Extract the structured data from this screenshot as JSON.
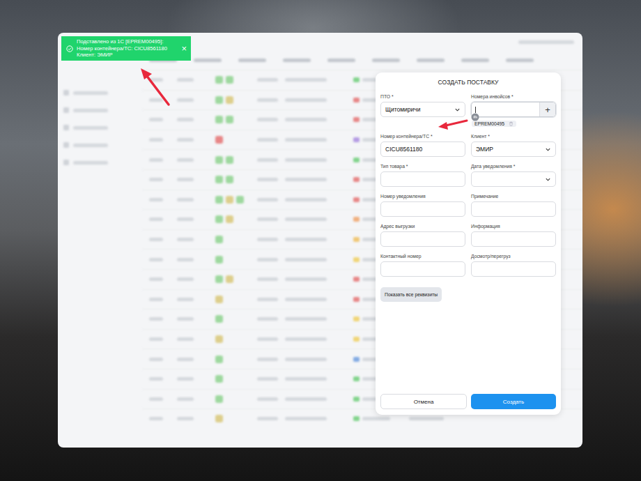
{
  "toast": {
    "lines": [
      "Подставлено из 1С [EPREM00495]:",
      "Номер контейнера/ТС: CICU8561180",
      "Клиент: ЭМИР"
    ],
    "close": "×"
  },
  "dialog": {
    "title": "СОЗДАТЬ ПОСТАВКУ",
    "fields": [
      {
        "label": "ПТО *",
        "kind": "select",
        "value": "Щитомиричи"
      },
      {
        "label": "Номера инвойсов *",
        "kind": "invoice",
        "value": "",
        "add": "+",
        "chips": [
          "EPREM00495"
        ]
      },
      {
        "label": "Номер контейнера/ТС *",
        "kind": "text",
        "value": "CICU8561180"
      },
      {
        "label": "Клиент *",
        "kind": "select",
        "value": "ЭМИР"
      },
      {
        "label": "Тип товара *",
        "kind": "text",
        "value": ""
      },
      {
        "label": "Дата уведомления *",
        "kind": "select",
        "value": ""
      },
      {
        "label": "Номер уведомления",
        "kind": "text",
        "value": ""
      },
      {
        "label": "Примечание",
        "kind": "text",
        "value": ""
      },
      {
        "label": "Адрес выгрузки",
        "kind": "text",
        "value": ""
      },
      {
        "label": "Информация",
        "kind": "text",
        "value": ""
      },
      {
        "label": "Контактный номер",
        "kind": "text",
        "value": ""
      },
      {
        "label": "Досмотр/перегруз",
        "kind": "text",
        "value": ""
      }
    ],
    "more_button": "Показать все реквизиты",
    "buttons": [
      {
        "label": "Отмена",
        "kind": "secondary"
      },
      {
        "label": "Создать",
        "kind": "primary"
      }
    ]
  },
  "background_table": {
    "rows": [
      {
        "marks": [
          "#8fd38f",
          "#8fd38f"
        ],
        "status": "#6fcf7a"
      },
      {
        "marks": [
          "#8fd38f",
          "#d9c879"
        ],
        "status": "#e57373"
      },
      {
        "marks": [
          "#8fd38f",
          "#8fd38f"
        ],
        "status": "#e57373"
      },
      {
        "marks": [
          "#e57373"
        ],
        "status": "#a98be0"
      },
      {
        "marks": [
          "#8fd38f",
          "#8fd38f"
        ],
        "status": "#6fcf7a"
      },
      {
        "marks": [
          "#8fd38f",
          "#8fd38f"
        ],
        "status": "#e57373"
      },
      {
        "marks": [
          "#8fd38f",
          "#d9c879",
          "#8fd38f"
        ],
        "status": "#e57373"
      },
      {
        "marks": [
          "#8fd38f",
          "#d9c879"
        ],
        "status": "#f0a46a"
      },
      {
        "marks": [
          "#8fd38f"
        ],
        "status": "#f0c060"
      },
      {
        "marks": [
          "#8fd38f"
        ],
        "status": "#f0d060"
      },
      {
        "marks": [
          "#8fd38f",
          "#d9c879"
        ],
        "status": "#e57373"
      },
      {
        "marks": [
          "#d9c879"
        ],
        "status": "#e57373"
      },
      {
        "marks": [
          "#8fd38f"
        ],
        "status": "#f0d060"
      },
      {
        "marks": [
          "#d9c879"
        ],
        "status": "#f0d060"
      },
      {
        "marks": [
          "#8fd38f"
        ],
        "status": "#6f9ee0"
      },
      {
        "marks": [
          "#8fd38f"
        ],
        "status": "#6fcf7a"
      },
      {
        "marks": [
          "#8fd38f"
        ],
        "status": "#6fcf7a"
      },
      {
        "marks": [
          "#d9c879"
        ],
        "status": "#6fcf7a"
      }
    ]
  }
}
